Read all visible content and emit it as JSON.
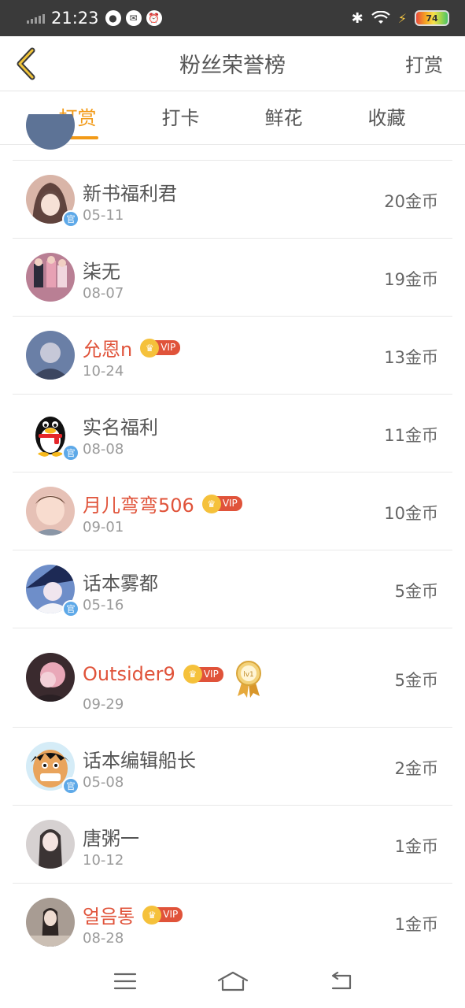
{
  "status_bar": {
    "time": "21:23",
    "battery": "74",
    "app_icons": [
      "wechat-icon",
      "message-icon",
      "alarm-icon"
    ]
  },
  "navbar": {
    "title": "粉丝荣誉榜",
    "action": "打赏"
  },
  "tabs": [
    {
      "label": "打赏",
      "active": true
    },
    {
      "label": "打卡",
      "active": false
    },
    {
      "label": "鲜花",
      "active": false
    },
    {
      "label": "收藏",
      "active": false
    }
  ],
  "entries": [
    {
      "name": "新书福利君",
      "date": "05-11",
      "amount": "20金币",
      "vip": false,
      "official": true,
      "official_label": "官",
      "avatar_color": "#d9b5a8"
    },
    {
      "name": "柒无",
      "date": "08-07",
      "amount": "19金币",
      "vip": false,
      "official": false,
      "avatar_color": "#b97f94"
    },
    {
      "name": "允恩n",
      "date": "10-24",
      "amount": "13金币",
      "vip": true,
      "vip_label": "VIP",
      "official": false,
      "avatar_color": "#6a7fa6"
    },
    {
      "name": "实名福利",
      "date": "08-08",
      "amount": "11金币",
      "vip": false,
      "official": true,
      "official_label": "官",
      "avatar_color": "#ffffff",
      "penguin": true
    },
    {
      "name": "月儿弯弯506",
      "date": "09-01",
      "amount": "10金币",
      "vip": true,
      "vip_label": "VIP",
      "official": false,
      "avatar_color": "#e6c1b6"
    },
    {
      "name": "话本雾都",
      "date": "05-16",
      "amount": "5金币",
      "vip": false,
      "official": true,
      "official_label": "官",
      "avatar_color": "#6e8ec9"
    },
    {
      "name": "Outsider9",
      "date": "09-29",
      "amount": "5金币",
      "vip": true,
      "vip_label": "VIP",
      "official": false,
      "medal": true,
      "medal_label": "lv1",
      "avatar_color": "#3a2a2e"
    },
    {
      "name": "话本编辑船长",
      "date": "05-08",
      "amount": "2金币",
      "vip": false,
      "official": true,
      "official_label": "官",
      "avatar_color": "#e9a45c"
    },
    {
      "name": "唐粥一",
      "date": "10-12",
      "amount": "1金币",
      "vip": false,
      "official": false,
      "avatar_color": "#d6d1d1"
    },
    {
      "name": "얼음통",
      "date": "08-28",
      "amount": "1金币",
      "vip": true,
      "vip_label": "VIP",
      "official": false,
      "avatar_color": "#a89c93"
    }
  ],
  "colors": {
    "accent": "#f29a17",
    "vip_name": "#e0533a",
    "official_badge": "#5ea9e8",
    "status_bar_bg": "#3a3a3a"
  }
}
